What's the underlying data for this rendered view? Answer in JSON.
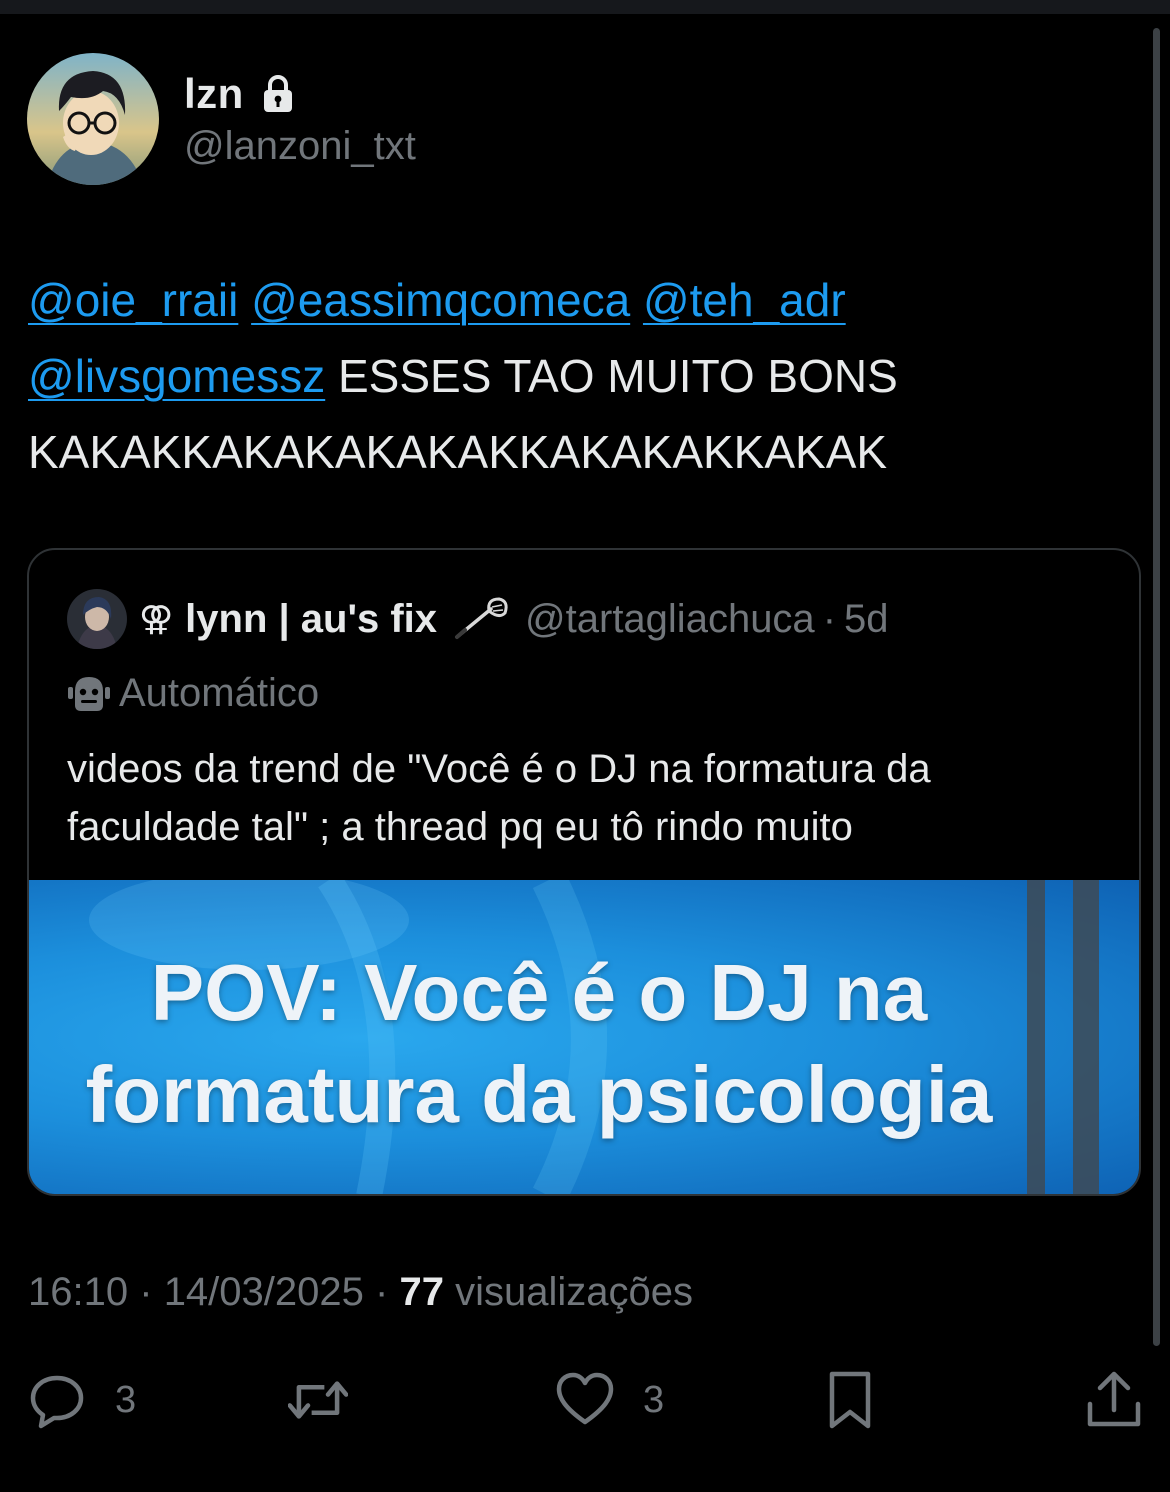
{
  "author": {
    "display_name": "lzn",
    "handle": "@lanzoni_txt",
    "locked": true
  },
  "tweet": {
    "mentions": [
      "@oie_rraii",
      "@eassimqcomeca",
      "@teh_adr",
      "@livsgomessz"
    ],
    "text_line2_rest": "ESSES TAO MUITO BONS",
    "text_line3": "KAKAKKAKAKAKAKAKKAKAKAKKAKAK"
  },
  "quote": {
    "symbol": "⚢",
    "name": "lynn | au's fix",
    "handle": "@tartagliachuca",
    "separator": "·",
    "time": "5d",
    "automated_label": "Automático",
    "text": "videos da trend de \"Você é  o DJ na formatura da faculdade tal\" ; a thread pq eu tô rindo muito",
    "media_text_line1": "POV: Você é o DJ na",
    "media_text_line2": "formatura da psicologia"
  },
  "meta": {
    "time": "16:10",
    "sep1": "·",
    "date": "14/03/2025",
    "sep2": "·",
    "views_count": "77",
    "views_label": "visualizações"
  },
  "actions": {
    "reply_count": "3",
    "like_count": "3"
  },
  "colors": {
    "background": "#000000",
    "text": "#e7e9ea",
    "muted": "#71767b",
    "link": "#1d9bf0",
    "border": "#2f3336"
  }
}
